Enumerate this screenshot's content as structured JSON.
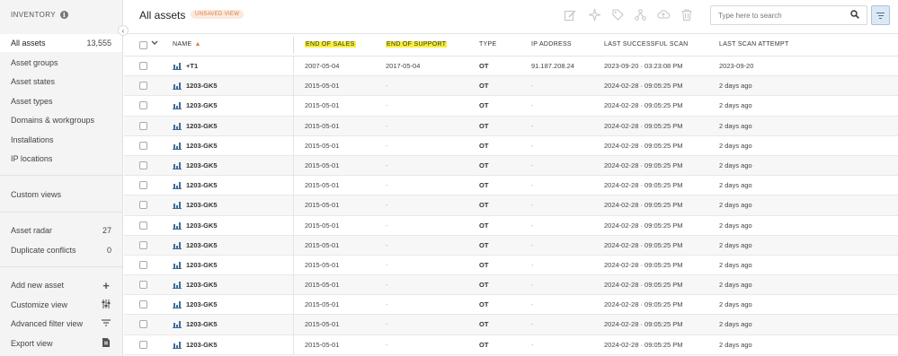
{
  "sidebar": {
    "header": "INVENTORY",
    "items": [
      {
        "label": "All assets",
        "count": "13,555"
      },
      {
        "label": "Asset groups"
      },
      {
        "label": "Asset states"
      },
      {
        "label": "Asset types"
      },
      {
        "label": "Domains & workgroups"
      },
      {
        "label": "Installations"
      },
      {
        "label": "IP locations"
      }
    ],
    "custom_views": "Custom views",
    "radar": {
      "label": "Asset radar",
      "count": "27"
    },
    "conflicts": {
      "label": "Duplicate conflicts",
      "count": "0"
    },
    "actions": [
      {
        "label": "Add new asset",
        "icon": "plus-icon"
      },
      {
        "label": "Customize view",
        "icon": "sliders-icon"
      },
      {
        "label": "Advanced filter view",
        "icon": "filter-lines-icon"
      },
      {
        "label": "Export view",
        "icon": "export-file-icon"
      }
    ]
  },
  "header": {
    "title": "All assets",
    "badge": "UNSAVED VIEW",
    "search_placeholder": "Type here to search"
  },
  "table": {
    "columns": {
      "name": "NAME",
      "end_of_sales": "END OF SALES",
      "end_of_support": "END OF SUPPORT",
      "type": "TYPE",
      "ip_address": "IP ADDRESS",
      "last_successful_scan": "LAST SUCCESSFUL SCAN",
      "last_scan_attempt": "LAST SCAN ATTEMPT"
    },
    "rows": [
      {
        "name": "+T1",
        "eos": "2007-05-04",
        "eosup": "2017-05-04",
        "type": "OT",
        "ip": "91.187.208.24",
        "last_scan": "2023-09-20 · 03:23:08 PM",
        "attempt": "2023-09-20"
      },
      {
        "name": "1203-GK5",
        "eos": "2015-05-01",
        "eosup": "-",
        "type": "OT",
        "ip": "-",
        "last_scan": "2024-02-28 · 09:05:25 PM",
        "attempt": "2 days ago"
      },
      {
        "name": "1203-GK5",
        "eos": "2015-05-01",
        "eosup": "-",
        "type": "OT",
        "ip": "-",
        "last_scan": "2024-02-28 · 09:05:25 PM",
        "attempt": "2 days ago"
      },
      {
        "name": "1203-GK5",
        "eos": "2015-05-01",
        "eosup": "-",
        "type": "OT",
        "ip": "-",
        "last_scan": "2024-02-28 · 09:05:25 PM",
        "attempt": "2 days ago"
      },
      {
        "name": "1203-GK5",
        "eos": "2015-05-01",
        "eosup": "-",
        "type": "OT",
        "ip": "-",
        "last_scan": "2024-02-28 · 09:05:25 PM",
        "attempt": "2 days ago"
      },
      {
        "name": "1203-GK5",
        "eos": "2015-05-01",
        "eosup": "-",
        "type": "OT",
        "ip": "-",
        "last_scan": "2024-02-28 · 09:05:25 PM",
        "attempt": "2 days ago"
      },
      {
        "name": "1203-GK5",
        "eos": "2015-05-01",
        "eosup": "-",
        "type": "OT",
        "ip": "-",
        "last_scan": "2024-02-28 · 09:05:25 PM",
        "attempt": "2 days ago"
      },
      {
        "name": "1203-GK5",
        "eos": "2015-05-01",
        "eosup": "-",
        "type": "OT",
        "ip": "-",
        "last_scan": "2024-02-28 · 09:05:25 PM",
        "attempt": "2 days ago"
      },
      {
        "name": "1203-GK5",
        "eos": "2015-05-01",
        "eosup": "-",
        "type": "OT",
        "ip": "-",
        "last_scan": "2024-02-28 · 09:05:25 PM",
        "attempt": "2 days ago"
      },
      {
        "name": "1203-GK5",
        "eos": "2015-05-01",
        "eosup": "-",
        "type": "OT",
        "ip": "-",
        "last_scan": "2024-02-28 · 09:05:25 PM",
        "attempt": "2 days ago"
      },
      {
        "name": "1203-GK5",
        "eos": "2015-05-01",
        "eosup": "-",
        "type": "OT",
        "ip": "-",
        "last_scan": "2024-02-28 · 09:05:25 PM",
        "attempt": "2 days ago"
      },
      {
        "name": "1203-GK5",
        "eos": "2015-05-01",
        "eosup": "-",
        "type": "OT",
        "ip": "-",
        "last_scan": "2024-02-28 · 09:05:25 PM",
        "attempt": "2 days ago"
      },
      {
        "name": "1203-GK5",
        "eos": "2015-05-01",
        "eosup": "-",
        "type": "OT",
        "ip": "-",
        "last_scan": "2024-02-28 · 09:05:25 PM",
        "attempt": "2 days ago"
      },
      {
        "name": "1203-GK5",
        "eos": "2015-05-01",
        "eosup": "-",
        "type": "OT",
        "ip": "-",
        "last_scan": "2024-02-28 · 09:05:25 PM",
        "attempt": "2 days ago"
      },
      {
        "name": "1203-GK5",
        "eos": "2015-05-01",
        "eosup": "-",
        "type": "OT",
        "ip": "-",
        "last_scan": "2024-02-28 · 09:05:25 PM",
        "attempt": "2 days ago"
      }
    ]
  },
  "colors": {
    "highlight": "#f7ee3a",
    "accent_orange": "#e07a3e",
    "asset_icon": "#3f6d9a"
  }
}
